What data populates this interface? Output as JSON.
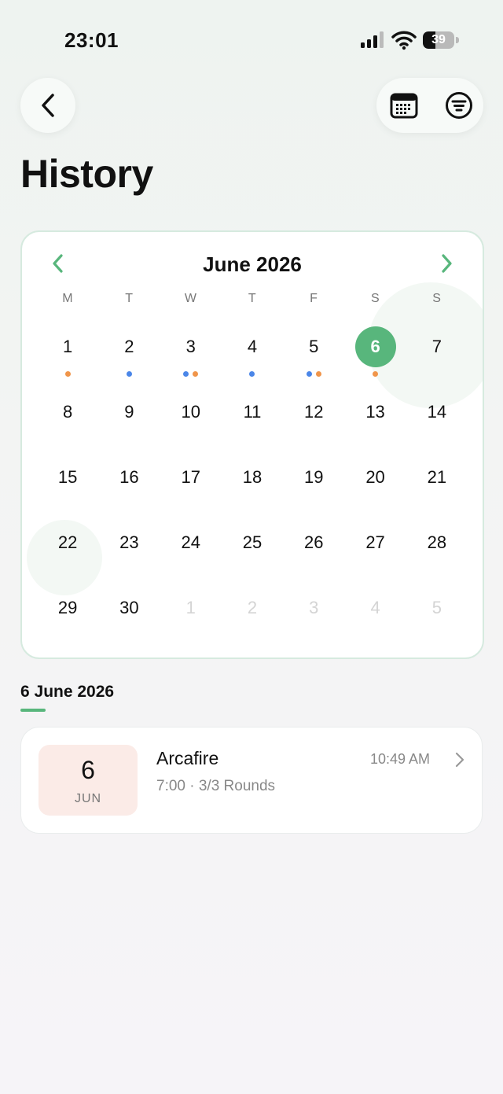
{
  "status_bar": {
    "time": "23:01",
    "battery": "39",
    "battery_fraction": 0.39
  },
  "header": {
    "title": "History"
  },
  "calendar": {
    "month_label": "June 2026",
    "weekdays": [
      "M",
      "T",
      "W",
      "T",
      "F",
      "S",
      "S"
    ],
    "days": [
      {
        "n": "1",
        "muted": false,
        "dots": [
          "orange"
        ]
      },
      {
        "n": "2",
        "muted": false,
        "dots": [
          "blue"
        ]
      },
      {
        "n": "3",
        "muted": false,
        "dots": [
          "blue",
          "orange"
        ]
      },
      {
        "n": "4",
        "muted": false,
        "dots": [
          "blue"
        ]
      },
      {
        "n": "5",
        "muted": false,
        "dots": [
          "blue",
          "orange"
        ]
      },
      {
        "n": "6",
        "muted": false,
        "dots": [
          "orange"
        ],
        "selected": true
      },
      {
        "n": "7",
        "muted": false,
        "dots": []
      },
      {
        "n": "8",
        "muted": false,
        "dots": []
      },
      {
        "n": "9",
        "muted": false,
        "dots": []
      },
      {
        "n": "10",
        "muted": false,
        "dots": []
      },
      {
        "n": "11",
        "muted": false,
        "dots": []
      },
      {
        "n": "12",
        "muted": false,
        "dots": []
      },
      {
        "n": "13",
        "muted": false,
        "dots": []
      },
      {
        "n": "14",
        "muted": false,
        "dots": []
      },
      {
        "n": "15",
        "muted": false,
        "dots": []
      },
      {
        "n": "16",
        "muted": false,
        "dots": []
      },
      {
        "n": "17",
        "muted": false,
        "dots": []
      },
      {
        "n": "18",
        "muted": false,
        "dots": []
      },
      {
        "n": "19",
        "muted": false,
        "dots": []
      },
      {
        "n": "20",
        "muted": false,
        "dots": []
      },
      {
        "n": "21",
        "muted": false,
        "dots": []
      },
      {
        "n": "22",
        "muted": false,
        "dots": []
      },
      {
        "n": "23",
        "muted": false,
        "dots": []
      },
      {
        "n": "24",
        "muted": false,
        "dots": []
      },
      {
        "n": "25",
        "muted": false,
        "dots": []
      },
      {
        "n": "26",
        "muted": false,
        "dots": []
      },
      {
        "n": "27",
        "muted": false,
        "dots": []
      },
      {
        "n": "28",
        "muted": false,
        "dots": []
      },
      {
        "n": "29",
        "muted": false,
        "dots": []
      },
      {
        "n": "30",
        "muted": false,
        "dots": []
      },
      {
        "n": "1",
        "muted": true,
        "dots": []
      },
      {
        "n": "2",
        "muted": true,
        "dots": []
      },
      {
        "n": "3",
        "muted": true,
        "dots": []
      },
      {
        "n": "4",
        "muted": true,
        "dots": []
      },
      {
        "n": "5",
        "muted": true,
        "dots": []
      }
    ]
  },
  "selected_date": {
    "label": "6 June 2026"
  },
  "entries": [
    {
      "badge_day": "6",
      "badge_month": "JUN",
      "name": "Arcafire",
      "detail": "7:00 · 3/3 Rounds",
      "time": "10:49 AM"
    }
  ],
  "colors": {
    "accent": "#58b67c",
    "dot_orange": "#f0954a",
    "dot_blue": "#4a86e8",
    "badge_bg": "#fbebe7"
  },
  "icons": {
    "back": "chevron-left-icon",
    "calendar_view": "calendar-grid-icon",
    "filter": "filter-icon",
    "prev_month": "chevron-left-icon",
    "next_month": "chevron-right-icon",
    "entry_open": "chevron-right-icon"
  }
}
